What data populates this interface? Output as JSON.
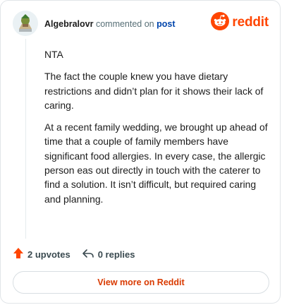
{
  "comment": {
    "username": "Algebralovr",
    "action_text": "commented on",
    "post_link": "post",
    "paragraphs": [
      "NTA",
      "The fact the couple knew you have dietary restrictions and didn’t plan for it shows their lack of caring.",
      "At a recent family wedding, we brought up ahead of time that a couple of family members have significant food allergies. In every case, the allergic person eas out directly in touch with the caterer to find a solution. It isn’t difficult, but required caring and planning."
    ]
  },
  "brand": {
    "wordmark": "reddit",
    "color": "#ff4500"
  },
  "actions": {
    "upvotes": "2 upvotes",
    "replies": "0 replies"
  },
  "cta": {
    "label": "View more on Reddit"
  },
  "icons": [
    "avatar",
    "reddit-logo-icon",
    "upvote-icon",
    "reply-icon"
  ]
}
